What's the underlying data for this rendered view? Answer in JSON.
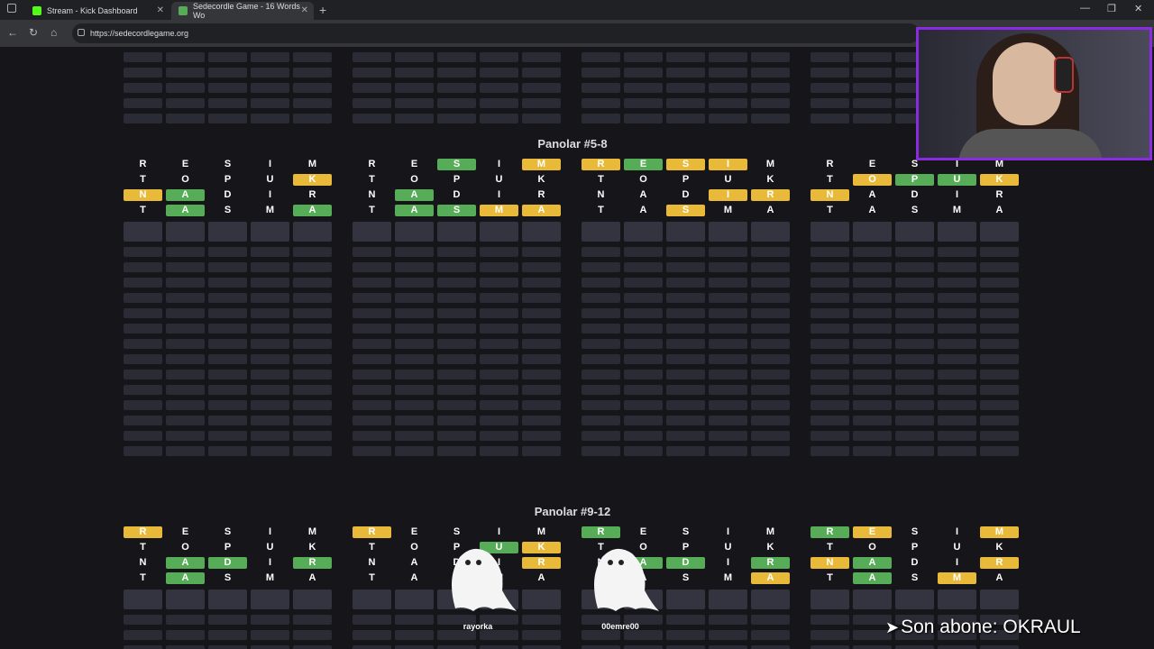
{
  "browser": {
    "tabs": [
      {
        "title": "Stream - Kick Dashboard",
        "favicon_color": "#53fc18"
      },
      {
        "title": "Sedecordle Game - 16 Words Wo",
        "favicon_color": "#57ac57"
      }
    ],
    "url": "https://sedecordlegame.org"
  },
  "colors": {
    "green": "#57ac57",
    "yellow": "#e9ba3a",
    "gray": "#343441",
    "background": "#16161a"
  },
  "panels": [
    {
      "title": "Panolar #5-8",
      "boards": [
        {
          "rows": [
            [
              [
                "R",
                "t"
              ],
              [
                "E",
                "t"
              ],
              [
                "S",
                "t"
              ],
              [
                "I",
                "t"
              ],
              [
                "M",
                "t"
              ]
            ],
            [
              [
                "T",
                "t"
              ],
              [
                "O",
                "t"
              ],
              [
                "P",
                "t"
              ],
              [
                "U",
                "t"
              ],
              [
                "K",
                "y"
              ]
            ],
            [
              [
                "N",
                "y"
              ],
              [
                "A",
                "g"
              ],
              [
                "D",
                "t"
              ],
              [
                "I",
                "t"
              ],
              [
                "R",
                "t"
              ]
            ],
            [
              [
                "T",
                "t"
              ],
              [
                "A",
                "g"
              ],
              [
                "S",
                "t"
              ],
              [
                "M",
                "t"
              ],
              [
                "A",
                "g"
              ]
            ]
          ]
        },
        {
          "rows": [
            [
              [
                "R",
                "t"
              ],
              [
                "E",
                "t"
              ],
              [
                "S",
                "g"
              ],
              [
                "I",
                "t"
              ],
              [
                "M",
                "y"
              ]
            ],
            [
              [
                "T",
                "t"
              ],
              [
                "O",
                "t"
              ],
              [
                "P",
                "t"
              ],
              [
                "U",
                "t"
              ],
              [
                "K",
                "t"
              ]
            ],
            [
              [
                "N",
                "t"
              ],
              [
                "A",
                "g"
              ],
              [
                "D",
                "t"
              ],
              [
                "I",
                "t"
              ],
              [
                "R",
                "t"
              ]
            ],
            [
              [
                "T",
                "t"
              ],
              [
                "A",
                "g"
              ],
              [
                "S",
                "g"
              ],
              [
                "M",
                "y"
              ],
              [
                "A",
                "y"
              ]
            ]
          ]
        },
        {
          "rows": [
            [
              [
                "R",
                "y"
              ],
              [
                "E",
                "g"
              ],
              [
                "S",
                "y"
              ],
              [
                "I",
                "y"
              ],
              [
                "M",
                "t"
              ]
            ],
            [
              [
                "T",
                "t"
              ],
              [
                "O",
                "t"
              ],
              [
                "P",
                "t"
              ],
              [
                "U",
                "t"
              ],
              [
                "K",
                "t"
              ]
            ],
            [
              [
                "N",
                "t"
              ],
              [
                "A",
                "t"
              ],
              [
                "D",
                "t"
              ],
              [
                "I",
                "y"
              ],
              [
                "R",
                "y"
              ]
            ],
            [
              [
                "T",
                "t"
              ],
              [
                "A",
                "t"
              ],
              [
                "S",
                "y"
              ],
              [
                "M",
                "t"
              ],
              [
                "A",
                "t"
              ]
            ]
          ]
        },
        {
          "rows": [
            [
              [
                "R",
                "t"
              ],
              [
                "E",
                "t"
              ],
              [
                "S",
                "t"
              ],
              [
                "I",
                "t"
              ],
              [
                "M",
                "t"
              ]
            ],
            [
              [
                "T",
                "t"
              ],
              [
                "O",
                "y"
              ],
              [
                "P",
                "g"
              ],
              [
                "U",
                "g"
              ],
              [
                "K",
                "y"
              ]
            ],
            [
              [
                "N",
                "y"
              ],
              [
                "A",
                "t"
              ],
              [
                "D",
                "t"
              ],
              [
                "I",
                "t"
              ],
              [
                "R",
                "t"
              ]
            ],
            [
              [
                "T",
                "t"
              ],
              [
                "A",
                "t"
              ],
              [
                "S",
                "t"
              ],
              [
                "M",
                "t"
              ],
              [
                "A",
                "t"
              ]
            ]
          ]
        }
      ]
    },
    {
      "title": "Panolar #9-12",
      "boards": [
        {
          "rows": [
            [
              [
                "R",
                "y"
              ],
              [
                "E",
                "t"
              ],
              [
                "S",
                "t"
              ],
              [
                "I",
                "t"
              ],
              [
                "M",
                "t"
              ]
            ],
            [
              [
                "T",
                "t"
              ],
              [
                "O",
                "t"
              ],
              [
                "P",
                "t"
              ],
              [
                "U",
                "t"
              ],
              [
                "K",
                "t"
              ]
            ],
            [
              [
                "N",
                "t"
              ],
              [
                "A",
                "g"
              ],
              [
                "D",
                "g"
              ],
              [
                "I",
                "t"
              ],
              [
                "R",
                "g"
              ]
            ],
            [
              [
                "T",
                "t"
              ],
              [
                "A",
                "g"
              ],
              [
                "S",
                "t"
              ],
              [
                "M",
                "t"
              ],
              [
                "A",
                "t"
              ]
            ]
          ]
        },
        {
          "rows": [
            [
              [
                "R",
                "y"
              ],
              [
                "E",
                "t"
              ],
              [
                "S",
                "t"
              ],
              [
                "I",
                "t"
              ],
              [
                "M",
                "t"
              ]
            ],
            [
              [
                "T",
                "t"
              ],
              [
                "O",
                "t"
              ],
              [
                "P",
                "t"
              ],
              [
                "U",
                "g"
              ],
              [
                "K",
                "y"
              ]
            ],
            [
              [
                "N",
                "t"
              ],
              [
                "A",
                "t"
              ],
              [
                "D",
                "t"
              ],
              [
                "I",
                "t"
              ],
              [
                "R",
                "y"
              ]
            ],
            [
              [
                "T",
                "t"
              ],
              [
                "A",
                "t"
              ],
              [
                "S",
                "t"
              ],
              [
                "M",
                "t"
              ],
              [
                "A",
                "t"
              ]
            ]
          ]
        },
        {
          "rows": [
            [
              [
                "R",
                "g"
              ],
              [
                "E",
                "t"
              ],
              [
                "S",
                "t"
              ],
              [
                "I",
                "t"
              ],
              [
                "M",
                "t"
              ]
            ],
            [
              [
                "T",
                "t"
              ],
              [
                "O",
                "t"
              ],
              [
                "P",
                "t"
              ],
              [
                "U",
                "t"
              ],
              [
                "K",
                "t"
              ]
            ],
            [
              [
                "N",
                "t"
              ],
              [
                "A",
                "g"
              ],
              [
                "D",
                "g"
              ],
              [
                "I",
                "t"
              ],
              [
                "R",
                "g"
              ]
            ],
            [
              [
                "T",
                "t"
              ],
              [
                "A",
                "t"
              ],
              [
                "S",
                "t"
              ],
              [
                "M",
                "t"
              ],
              [
                "A",
                "y"
              ]
            ]
          ]
        },
        {
          "rows": [
            [
              [
                "R",
                "g"
              ],
              [
                "E",
                "y"
              ],
              [
                "S",
                "t"
              ],
              [
                "I",
                "t"
              ],
              [
                "M",
                "y"
              ]
            ],
            [
              [
                "T",
                "t"
              ],
              [
                "O",
                "t"
              ],
              [
                "P",
                "t"
              ],
              [
                "U",
                "t"
              ],
              [
                "K",
                "t"
              ]
            ],
            [
              [
                "N",
                "y"
              ],
              [
                "A",
                "g"
              ],
              [
                "D",
                "t"
              ],
              [
                "I",
                "t"
              ],
              [
                "R",
                "y"
              ]
            ],
            [
              [
                "T",
                "t"
              ],
              [
                "A",
                "g"
              ],
              [
                "S",
                "t"
              ],
              [
                "M",
                "y"
              ],
              [
                "A",
                "t"
              ]
            ]
          ]
        }
      ]
    }
  ],
  "ghosts": [
    {
      "name": "rayorka"
    },
    {
      "name": "00emre00"
    }
  ],
  "overlay": {
    "arrow": "➤",
    "text": "Son abone: OKRAUL"
  }
}
